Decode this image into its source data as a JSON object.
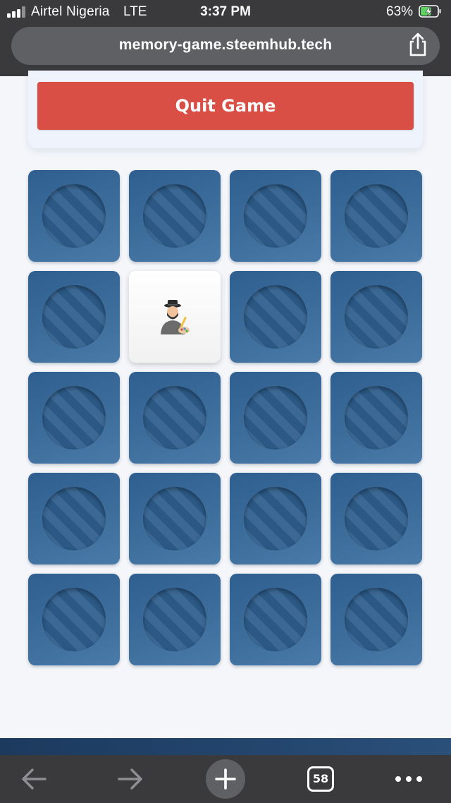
{
  "status_bar": {
    "carrier": "Airtel Nigeria",
    "network": "LTE",
    "time": "3:37 PM",
    "battery_percent": "63%",
    "battery_level": 0.63,
    "signal_bars_active": 3,
    "signal_bars_total": 4
  },
  "browser": {
    "url": "memory-game.steemhub.tech",
    "share_icon": "share-icon",
    "tab_count": "58",
    "toolbar_icons": [
      "back-arrow-icon",
      "forward-arrow-icon",
      "plus-icon",
      "tabs-icon",
      "more-dots-icon"
    ]
  },
  "game": {
    "quit_label": "Quit Game",
    "quit_color": "#d94e45",
    "card_back_color": "#3a6a98",
    "columns": 4,
    "rows": 5,
    "cards": [
      {
        "flipped": false
      },
      {
        "flipped": false
      },
      {
        "flipped": false
      },
      {
        "flipped": false
      },
      {
        "flipped": false
      },
      {
        "flipped": true,
        "face": "artist-emoji"
      },
      {
        "flipped": false
      },
      {
        "flipped": false
      },
      {
        "flipped": false
      },
      {
        "flipped": false
      },
      {
        "flipped": false
      },
      {
        "flipped": false
      },
      {
        "flipped": false
      },
      {
        "flipped": false
      },
      {
        "flipped": false
      },
      {
        "flipped": false
      },
      {
        "flipped": false
      },
      {
        "flipped": false
      },
      {
        "flipped": false
      },
      {
        "flipped": false
      }
    ]
  }
}
